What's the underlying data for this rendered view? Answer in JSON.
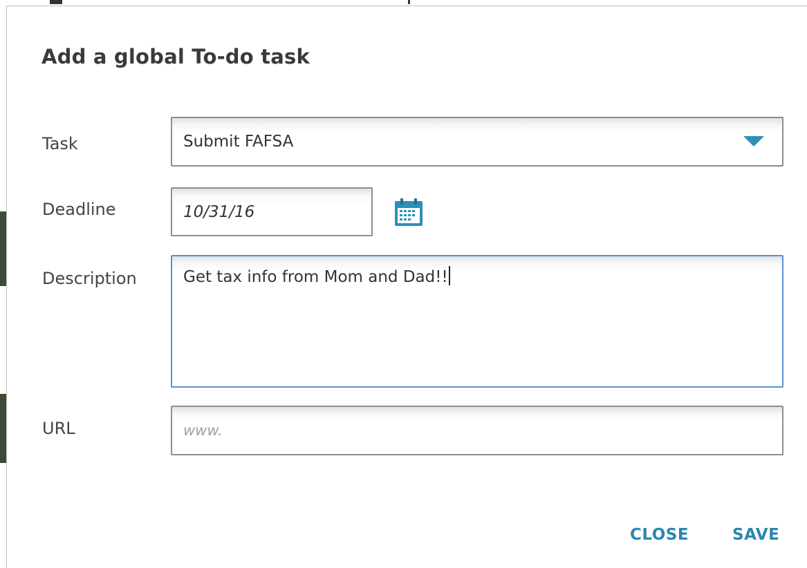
{
  "dialog": {
    "title": "Add a global To-do task",
    "accent_color": "#2e8fb8",
    "focus_border_color": "#5b8fcf"
  },
  "form": {
    "task": {
      "label": "Task",
      "selected_value": "Submit FAFSA",
      "icon": "chevron-down-icon"
    },
    "deadline": {
      "label": "Deadline",
      "value": "10/31/16",
      "icon": "calendar-icon"
    },
    "description": {
      "label": "Description",
      "value": "Get tax info from Mom and Dad!!"
    },
    "url": {
      "label": "URL",
      "value": "",
      "placeholder": "www."
    }
  },
  "actions": {
    "close_label": "CLOSE",
    "save_label": "SAVE"
  }
}
